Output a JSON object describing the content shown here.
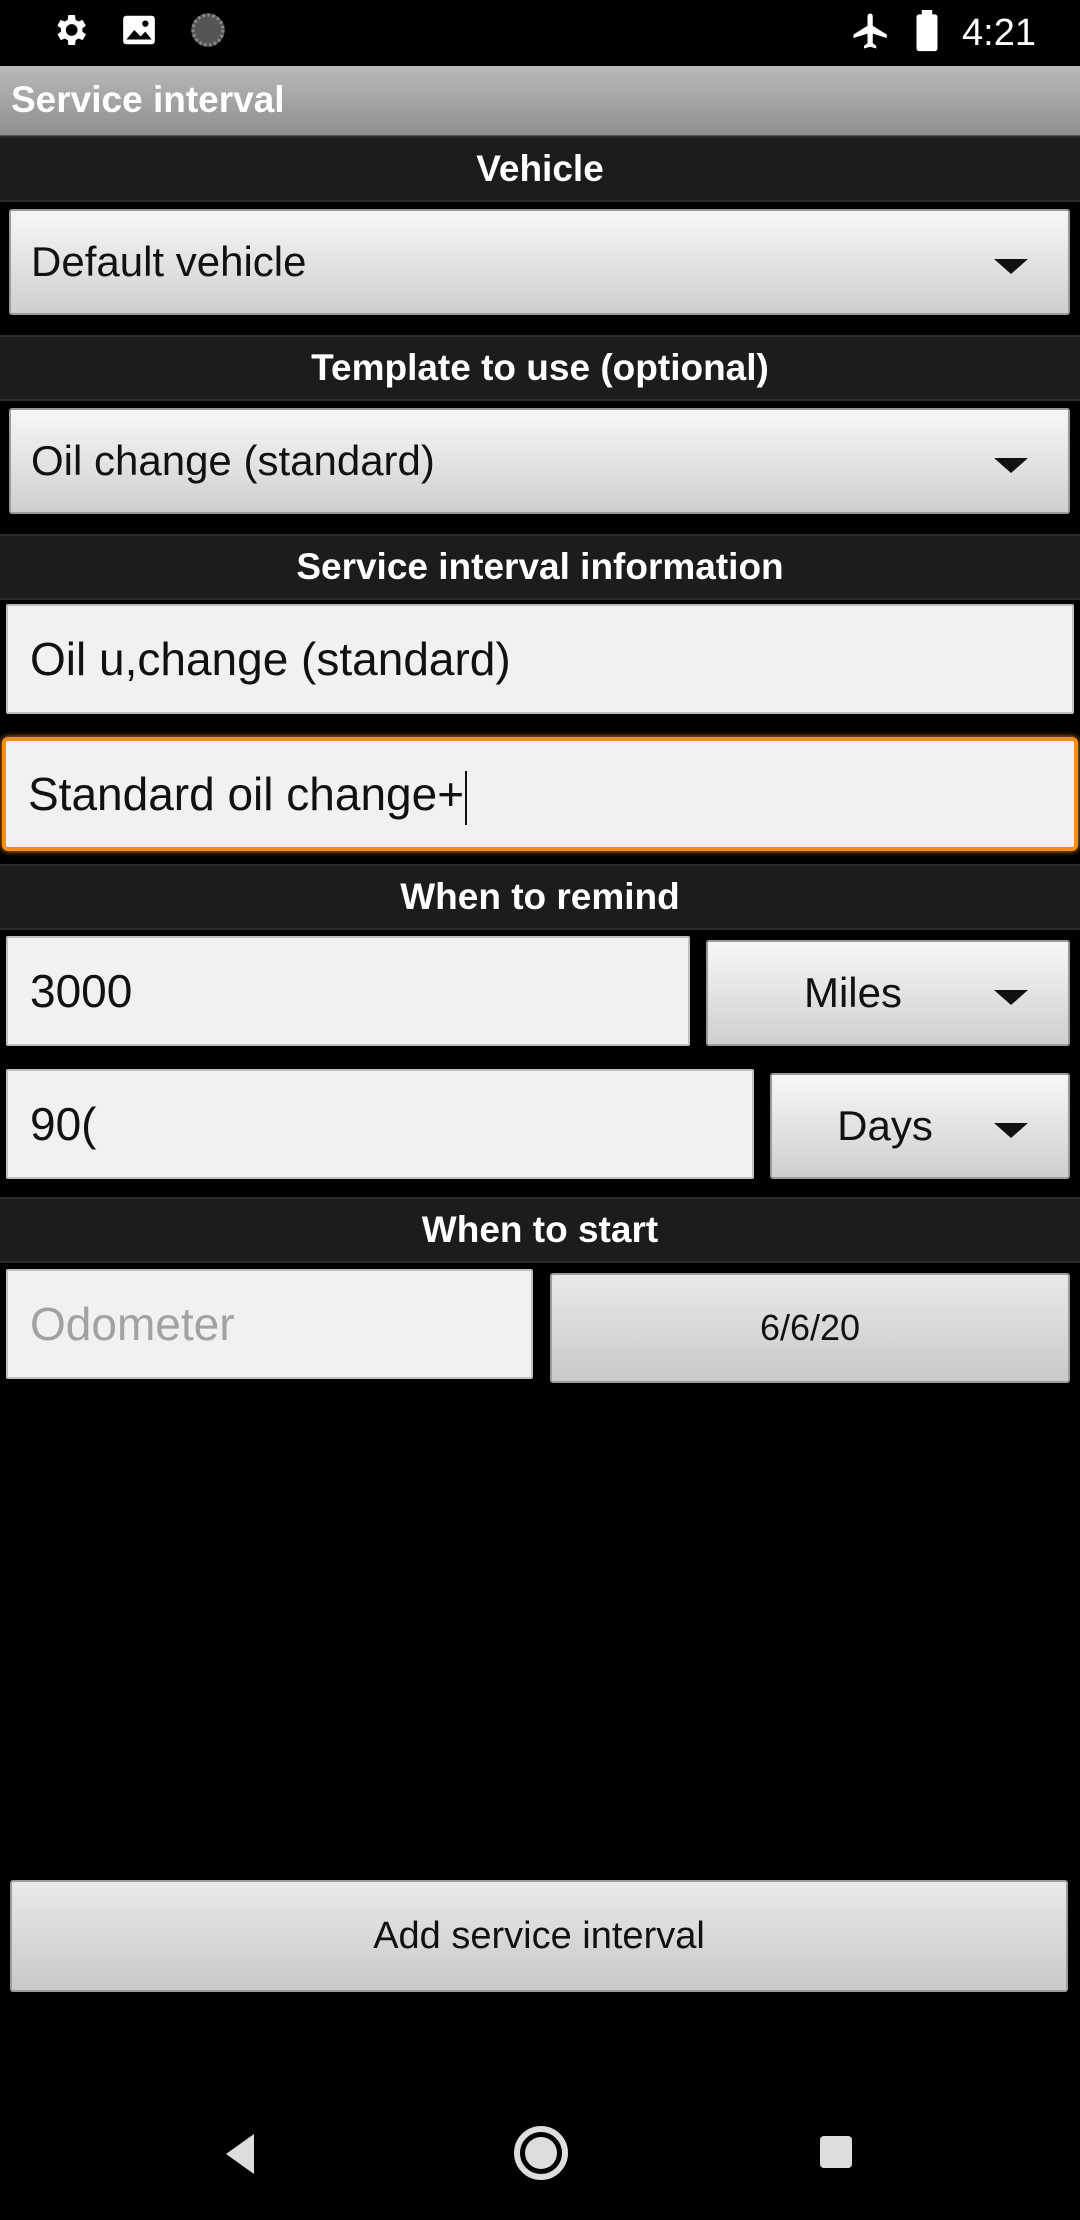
{
  "status_bar": {
    "time": "4:21",
    "icons_left": [
      "settings-icon",
      "image-icon",
      "loading-icon"
    ],
    "icons_right": [
      "airplane-mode-icon",
      "battery-icon"
    ]
  },
  "app": {
    "title": "Service interval"
  },
  "sections": {
    "vehicle": "Vehicle",
    "template": "Template to use (optional)",
    "info": "Service interval information",
    "remind": "When to remind",
    "start": "When to start"
  },
  "vehicle": {
    "selected": "Default vehicle"
  },
  "template": {
    "selected": "Oil change (standard)"
  },
  "info": {
    "name_value": "Oil u,change (standard)",
    "description_value": "Standard oil change+"
  },
  "remind": {
    "distance_value": "3000",
    "distance_unit": "Miles",
    "time_value": "90(",
    "time_unit": "Days"
  },
  "start": {
    "odometer_placeholder": "Odometer",
    "date": "6/6/20"
  },
  "actions": {
    "add_label": "Add service interval"
  },
  "colors": {
    "focus_accent": "#f28c1a"
  }
}
